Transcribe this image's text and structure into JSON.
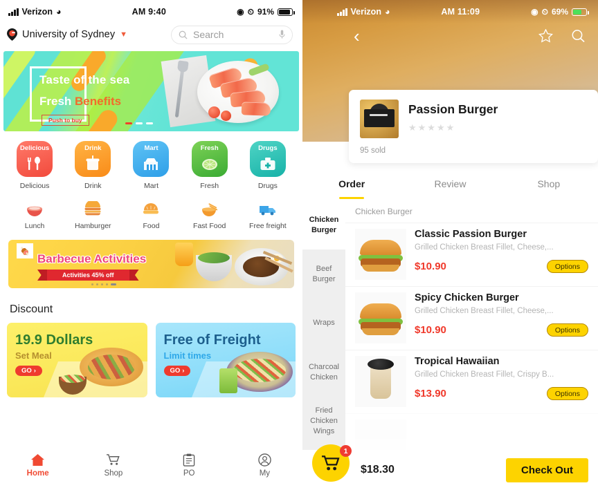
{
  "left_phone": {
    "status_bar": {
      "carrier": "Verizon",
      "time": "AM 9:40",
      "battery": "91%",
      "wifi_icon": "wifi-icon",
      "signal_icon": "signal-bars-icon"
    },
    "header": {
      "logo_icon": "location-pin-logo-icon",
      "campus": "University of Sydney",
      "caret_icon": "chevron-down-icon",
      "search_placeholder": "Search",
      "search_value": "",
      "search_icon": "search-icon",
      "mic_icon": "microphone-icon"
    },
    "hero_banner": {
      "line1": "Taste of the sea",
      "line2_white": "Fresh ",
      "line2_orange": "Benefits",
      "cta": "Push to buy",
      "dots": 3,
      "active_dot": 0
    },
    "categories_row1": [
      {
        "tile_text": "Delicious",
        "label": "Delicious",
        "icon": "fork-spoon-icon",
        "glyph": "ἷ4",
        "color": "#f24a3c"
      },
      {
        "tile_text": "Drink",
        "label": "Drink",
        "icon": "cup-icon",
        "glyph": "□",
        "color": "#f98b18"
      },
      {
        "tile_text": "Mart",
        "label": "Mart",
        "icon": "shopping-cart-icon",
        "glyph": "□",
        "color": "#2e9fe8"
      },
      {
        "tile_text": "Fresh",
        "label": "Fresh",
        "icon": "lime-slice-icon",
        "glyph": "□",
        "color": "#3aab33"
      },
      {
        "tile_text": "Drugs",
        "label": "Drugs",
        "icon": "medical-kit-icon",
        "glyph": "□",
        "color": "#17b2a8"
      }
    ],
    "categories_row2": [
      {
        "label": "Lunch",
        "icon": "rice-bowl-icon",
        "glyph": "🍚"
      },
      {
        "label": "Hamburger",
        "icon": "hamburger-icon",
        "glyph": "🍔"
      },
      {
        "label": "Food",
        "icon": "bread-icon",
        "glyph": "🍞"
      },
      {
        "label": "Fast Food",
        "icon": "takeout-box-icon",
        "glyph": "🍜"
      },
      {
        "label": "Free freight",
        "icon": "delivery-truck-icon",
        "glyph": "🚚"
      }
    ],
    "bbq_banner": {
      "title": "Barbecue Activities",
      "ribbon": "Activities 45% off",
      "logo_icon": "bbq-logo-icon"
    },
    "discount": {
      "heading": "Discount",
      "cards": [
        {
          "title": "19.9 Dollars",
          "subtitle": "Set Meal",
          "button": "GO"
        },
        {
          "title": "Free of Freight",
          "subtitle": "Limit times",
          "button": "GO"
        }
      ]
    },
    "tabbar": [
      {
        "label": "Home",
        "icon": "home-icon",
        "glyph": "⌂",
        "active": true
      },
      {
        "label": "Shop",
        "icon": "shopping-cart-icon",
        "glyph": "Ὥ2",
        "active": false
      },
      {
        "label": "PO",
        "icon": "clipboard-icon",
        "glyph": "ὌB",
        "active": false
      },
      {
        "label": "My",
        "icon": "user-account-icon",
        "glyph": "Ⓔ",
        "active": false
      }
    ]
  },
  "right_phone": {
    "status_bar": {
      "carrier": "Verizon",
      "time": "AM 11:09",
      "battery": "69%",
      "wifi_icon": "wifi-icon",
      "signal_icon": "signal-bars-icon"
    },
    "nav": {
      "back_icon": "back-chevron-icon",
      "favorite_icon": "star-outline-icon",
      "search_icon": "search-icon"
    },
    "store": {
      "name": "Passion Burger",
      "logo_icon": "store-logo-icon",
      "rating": 0,
      "rating_max": 5,
      "sold": "95 sold"
    },
    "tabs": [
      {
        "label": "Order",
        "active": true
      },
      {
        "label": "Review",
        "active": false
      },
      {
        "label": "Shop",
        "active": false
      }
    ],
    "sidebar": [
      {
        "label": "Chicken Burger",
        "active": true
      },
      {
        "label": "Beef Burger",
        "active": false
      },
      {
        "label": "Wraps",
        "active": false
      },
      {
        "label": "Charcoal Chicken",
        "active": false
      },
      {
        "label": "Fried Chicken Wings",
        "active": false
      }
    ],
    "group_title": "Chicken Burger",
    "items": [
      {
        "name": "Classic Passion Burger",
        "desc": "Grilled Chicken Breast Fillet, Cheese,...",
        "price": "$10.90",
        "options": "Options",
        "thumb": "burger-photo"
      },
      {
        "name": "Spicy Chicken Burger",
        "desc": "Grilled Chicken Breast Fillet, Cheese,...",
        "price": "$10.90",
        "options": "Options",
        "thumb": "burger-photo"
      },
      {
        "name": "Tropical Hawaiian",
        "desc": "Grilled Chicken Breast Fillet, Crispy B...",
        "price": "$13.90",
        "options": "Options",
        "thumb": "drink-cup-photo"
      }
    ],
    "cart": {
      "cart_icon": "shopping-cart-icon",
      "badge": "1",
      "total": "$18.30",
      "checkout": "Check Out"
    }
  }
}
